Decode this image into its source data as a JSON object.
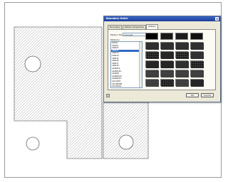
{
  "dialog": {
    "title": "Boundary Hatch",
    "close_label": "×",
    "tabs": [
      {
        "label": "Boundary"
      },
      {
        "label": "Pattern Properties"
      },
      {
        "label": "Pattern"
      }
    ],
    "pattern_file_label": "Pattern file:",
    "pattern_file_value": "acad.pat",
    "patterns_label": "Patterns:",
    "patterns": [
      {
        "label": "SOLID"
      },
      {
        "label": "ANGLE"
      },
      {
        "label": "ANSI31"
      },
      {
        "label": "ANSI32"
      },
      {
        "label": "ANSI33"
      },
      {
        "label": "ANSI34"
      },
      {
        "label": "ANSI35"
      },
      {
        "label": "ANSI36"
      },
      {
        "label": "ANSI37"
      },
      {
        "label": "ANSI38"
      },
      {
        "label": "AR-B816"
      },
      {
        "label": "AR-B816C"
      },
      {
        "label": "AR-B88"
      },
      {
        "label": "AR-BRELM"
      },
      {
        "label": "AR-BRSTD"
      },
      {
        "label": "AR-CONC"
      },
      {
        "label": "AR-HBONE"
      },
      {
        "label": "AR-PARQ1"
      }
    ],
    "selected_pattern_index": 3,
    "help_label": "?",
    "ok_label": "OK",
    "cancel_label": "Cancel"
  },
  "colors": {
    "title_bar": "#2a4fb0",
    "dialog_bg": "#ece9d8",
    "selection": "#316ac5",
    "hatch": "#8c8c8c"
  },
  "icons": {
    "close": "close-icon",
    "help": "help-icon",
    "dropdown": "chevron-down-icon"
  }
}
